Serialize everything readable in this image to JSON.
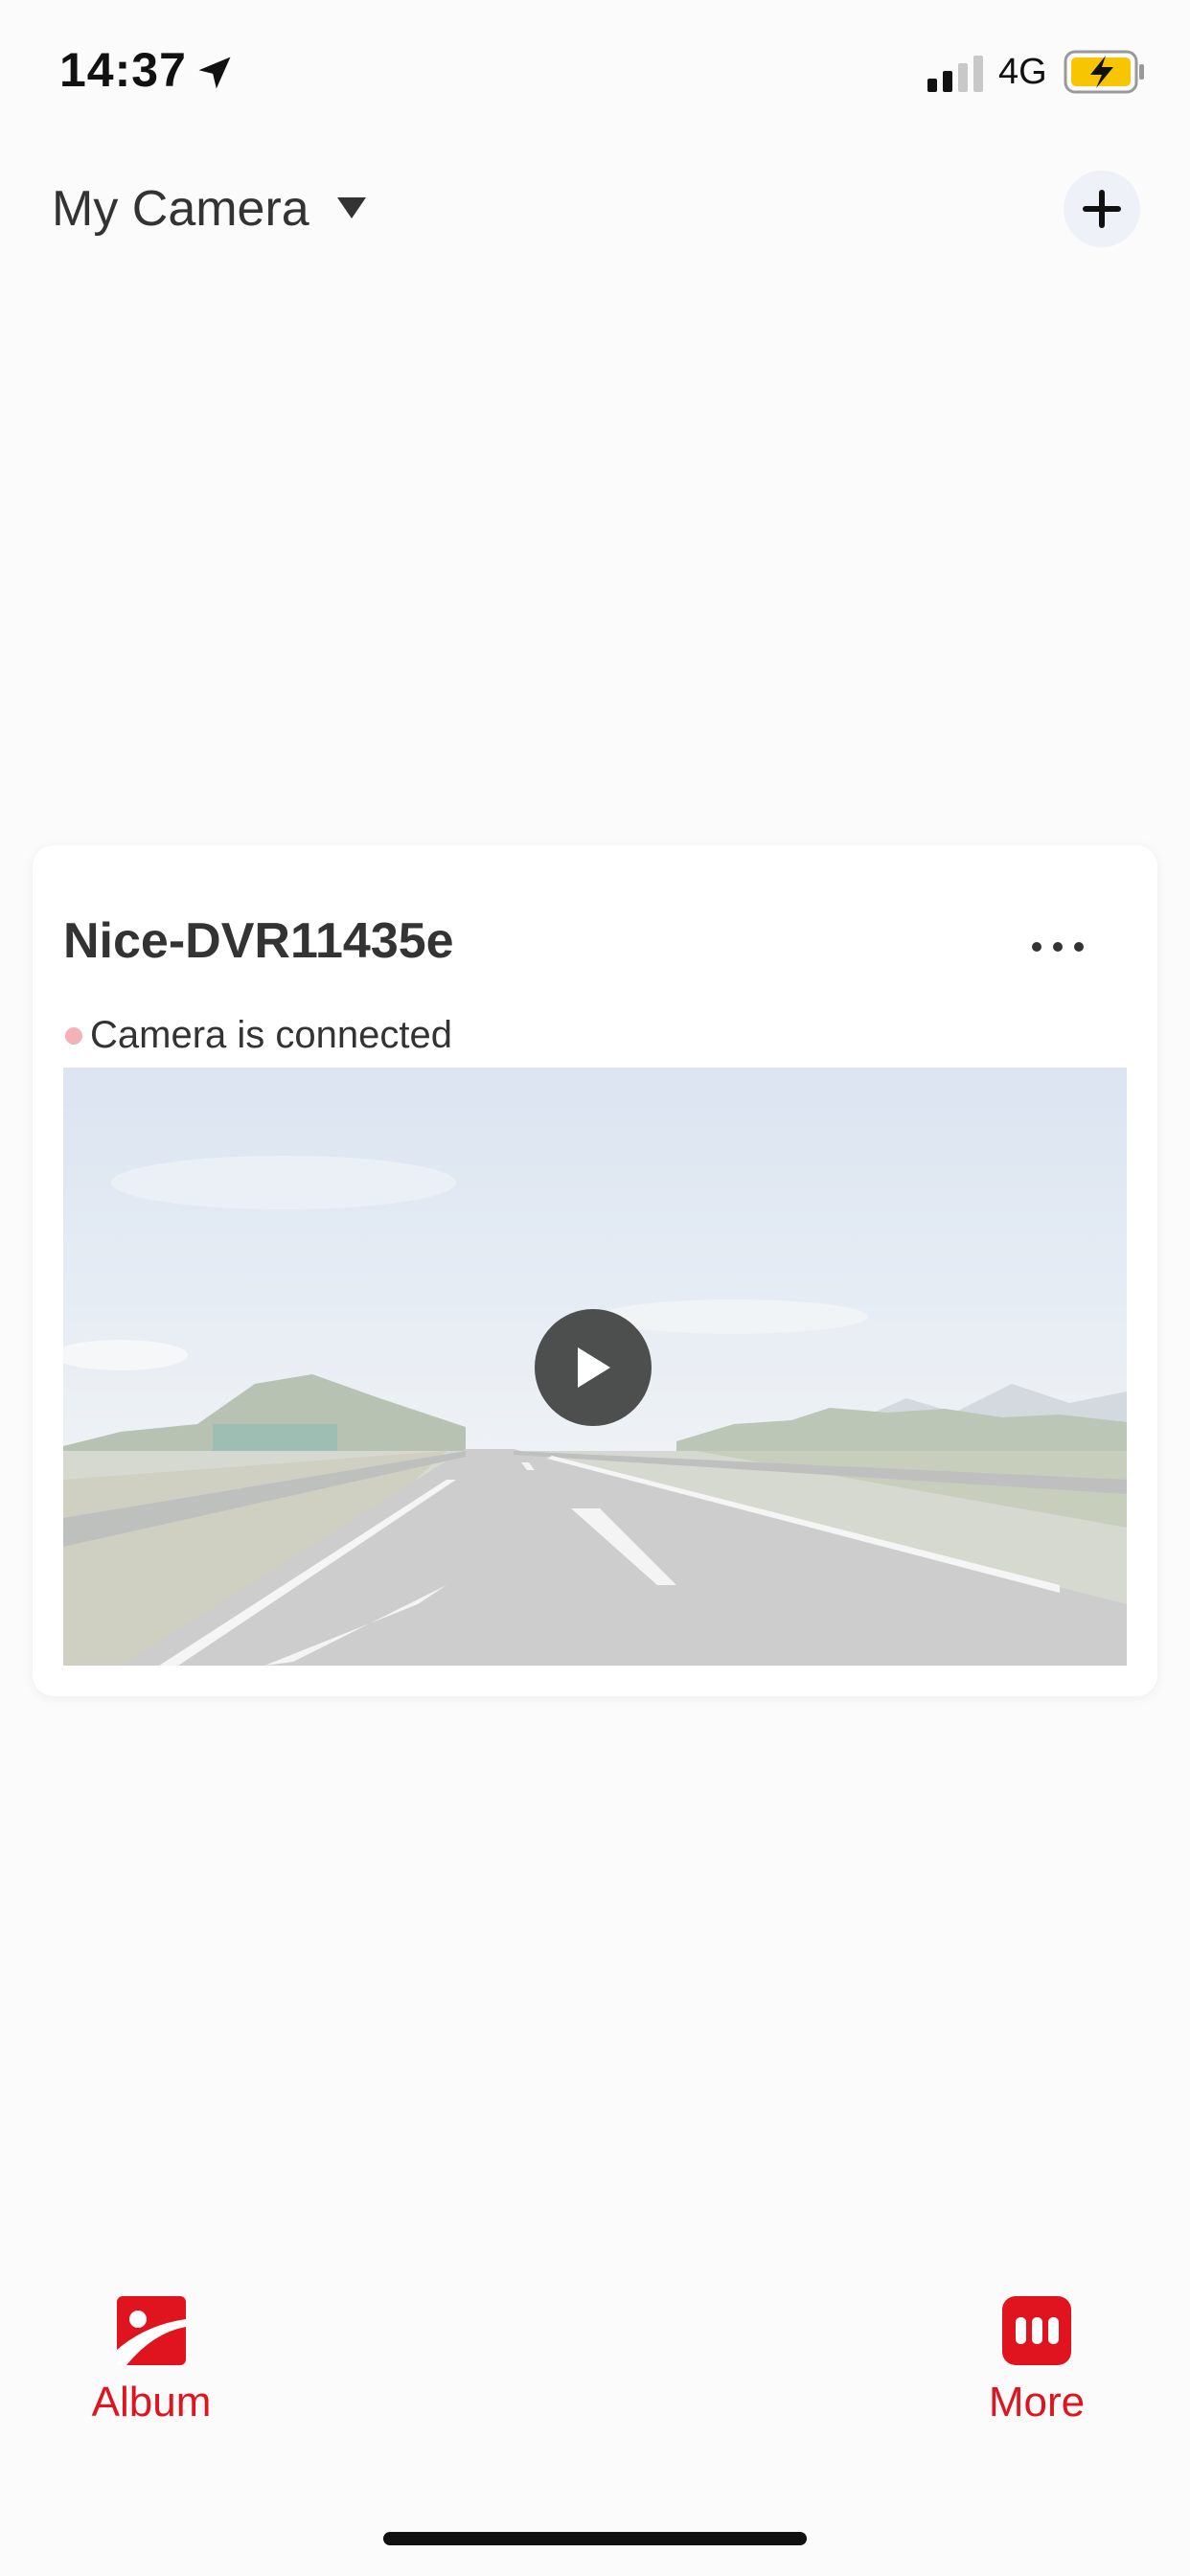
{
  "status_bar": {
    "time": "14:37",
    "network": "4G",
    "icons": [
      "location-arrow-icon",
      "signal-icon",
      "battery-charging-icon"
    ]
  },
  "header": {
    "title": "My Camera",
    "add_icon": "plus-icon"
  },
  "camera_card": {
    "name": "Nice-DVR11435e",
    "status": "Camera is connected",
    "status_color": "#f5b2b6",
    "preview_icon": "play-icon"
  },
  "bottom_nav": {
    "album_label": "Album",
    "more_label": "More",
    "accent_color": "#e0141e"
  }
}
